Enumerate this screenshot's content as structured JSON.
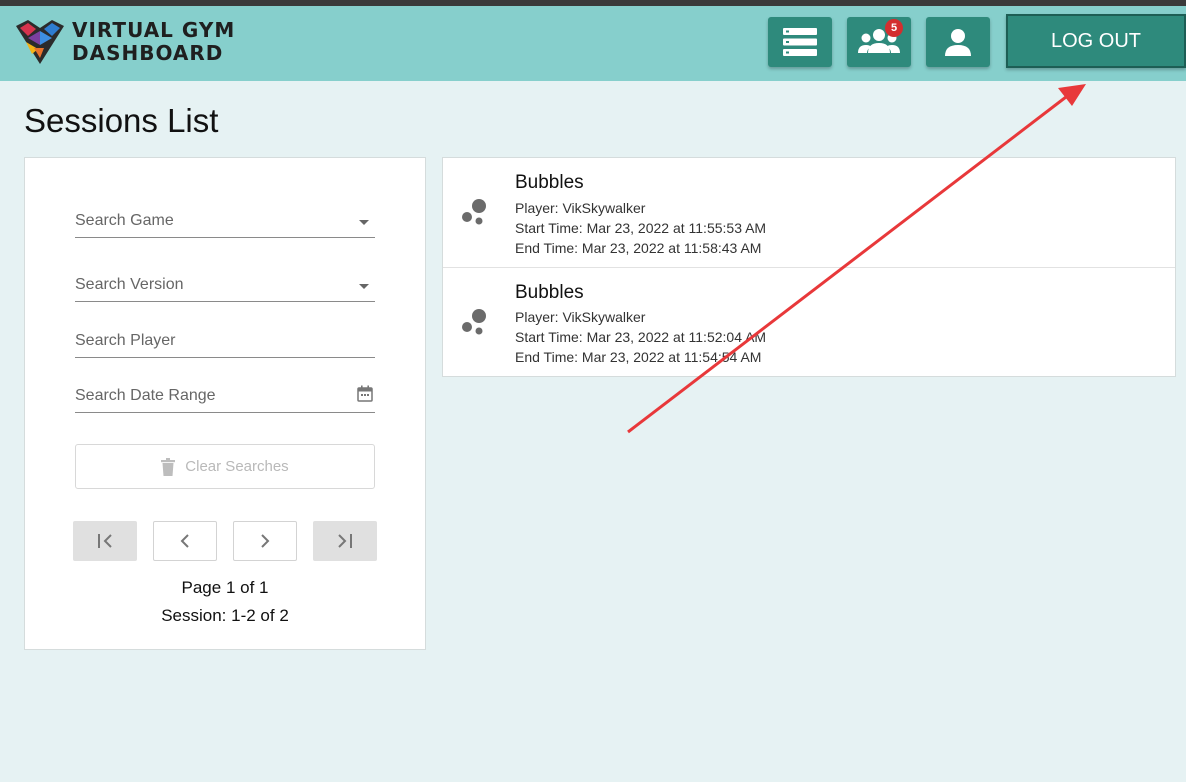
{
  "header": {
    "logo_line1": "VIRTUAL GYM",
    "logo_line2": "DASHBOARD",
    "notification_count": "5",
    "logout_label": "LOG OUT"
  },
  "page": {
    "title": "Sessions List"
  },
  "filters": {
    "game_label": "Search Game",
    "version_label": "Search Version",
    "player_label": "Search Player",
    "date_label": "Search Date Range",
    "clear_label": "Clear Searches"
  },
  "pagination": {
    "page_text": "Page 1 of 1",
    "session_text": "Session: 1-2 of 2"
  },
  "sessions": [
    {
      "game": "Bubbles",
      "player": "Player: VikSkywalker",
      "start": "Start Time: Mar 23, 2022 at 11:55:53 AM",
      "end": "End Time: Mar 23, 2022 at 11:58:43 AM"
    },
    {
      "game": "Bubbles",
      "player": "Player: VikSkywalker",
      "start": "Start Time: Mar 23, 2022 at 11:52:04 AM",
      "end": "End Time: Mar 23, 2022 at 11:54:54 AM"
    }
  ],
  "colors": {
    "header_bg": "#86cfcc",
    "button_bg": "#2e8a7c",
    "page_bg": "#e6f2f3",
    "badge": "#d32f2f",
    "annotation_arrow": "#e8383a"
  },
  "icons": {
    "list_button": "list-icon",
    "users_button": "group-icon",
    "profile_button": "person-icon",
    "session_item": "bubbles-icon"
  }
}
